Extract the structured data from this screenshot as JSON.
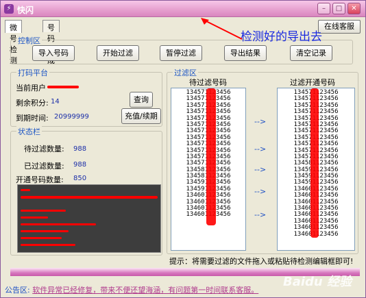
{
  "window": {
    "title": "快闪"
  },
  "tabs": [
    {
      "label": "微号检测"
    },
    {
      "label": "号码生成"
    }
  ],
  "service_button": "在线客服",
  "annotation": "检测好的导出去",
  "control": {
    "label": "控制区",
    "buttons": [
      "导入号码",
      "开始过滤",
      "暂停过滤",
      "导出结果",
      "清空记录"
    ]
  },
  "platform": {
    "label": "打码平台",
    "current_user_label": "当前用户",
    "points_label": "剩余积分:",
    "points_value": "14",
    "expiry_label": "到期时间:",
    "expiry_value": "20999999",
    "query_button": "查询",
    "recharge_button": "充值/续期"
  },
  "status": {
    "label": "状态栏",
    "pending_label": "待过滤数量:",
    "pending_value": "988",
    "filtered_label": "已过滤数量:",
    "filtered_value": "988",
    "open_label": "开通号码数量:",
    "open_value": "850"
  },
  "filter": {
    "label": "过滤区",
    "pending_header": "待过滤号码",
    "open_header": "过滤开通号码",
    "pending_list": [
      "134571123456",
      "134571123456",
      "134571123456",
      "134571123456",
      "134571123456",
      "134571123456",
      "134571123456",
      "134571123456",
      "134571123456",
      "134571123456",
      "134571123456",
      "134571123456",
      "134581123456",
      "134581123456",
      "134591123456",
      "134591123456",
      "134601123456",
      "134601123456",
      "134601123456",
      "134601123456"
    ],
    "open_list": [
      "134571123456",
      "134571123456",
      "134571123456",
      "134571123456",
      "134571123456",
      "134571123456",
      "134571123456",
      "134571123456",
      "134571123456",
      "134571123456",
      "134571123456",
      "134581123456",
      "134591123456",
      "134591123456",
      "134591123456",
      "134601123456",
      "134601123456",
      "134601123456",
      "134601123456",
      "134601123456",
      "134601123456",
      "134601123456",
      "134601123456"
    ],
    "arrow": "-->"
  },
  "hint": "提示：将需要过滤的文件拖入或粘贴待检测编辑框即可!",
  "notice_label": "公告区:",
  "notice_text": "软件异常已经修复，带来不便还望海涵，有问题第一时间联系客服。",
  "watermark": "Baidu 经验"
}
